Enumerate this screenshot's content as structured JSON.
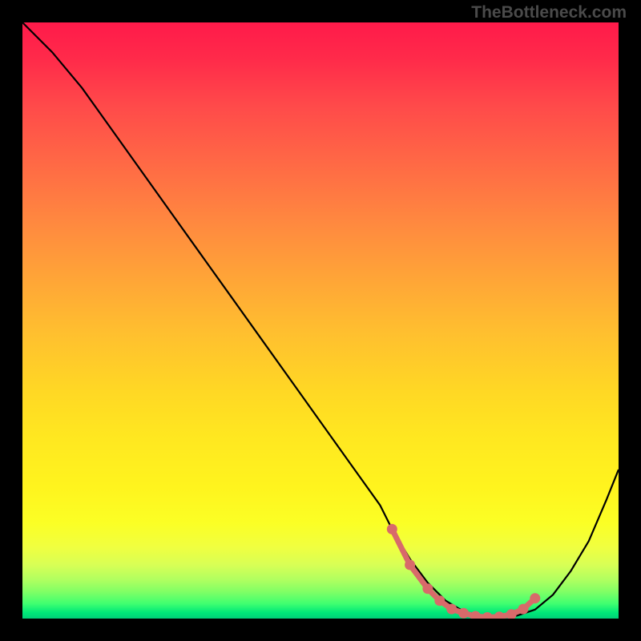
{
  "watermark": "TheBottleneck.com",
  "chart_data": {
    "type": "line",
    "title": "",
    "xlabel": "",
    "ylabel": "",
    "xlim": [
      0,
      100
    ],
    "ylim": [
      0,
      100
    ],
    "series": [
      {
        "name": "bottleneck-curve",
        "x": [
          0,
          5,
          10,
          15,
          20,
          25,
          30,
          35,
          40,
          45,
          50,
          55,
          60,
          62,
          65,
          68,
          71,
          74,
          77,
          80,
          83,
          86,
          89,
          92,
          95,
          98,
          100
        ],
        "y": [
          100,
          95,
          89,
          82,
          75,
          68,
          61,
          54,
          47,
          40,
          33,
          26,
          19,
          15,
          10,
          6,
          3,
          1.2,
          0.5,
          0.2,
          0.5,
          1.5,
          4,
          8,
          13,
          20,
          25
        ]
      }
    ],
    "highlight": {
      "name": "optimal-zone",
      "x": [
        62,
        65,
        68,
        70,
        72,
        74,
        76,
        78,
        80,
        82,
        84,
        86
      ],
      "y": [
        15,
        9,
        5,
        3,
        1.6,
        0.9,
        0.4,
        0.2,
        0.3,
        0.7,
        1.6,
        3.4
      ]
    },
    "colors": {
      "curve": "#000000",
      "markers": "#d86a6a",
      "gradient_top": "#ff1a4a",
      "gradient_bottom": "#00d078"
    }
  }
}
